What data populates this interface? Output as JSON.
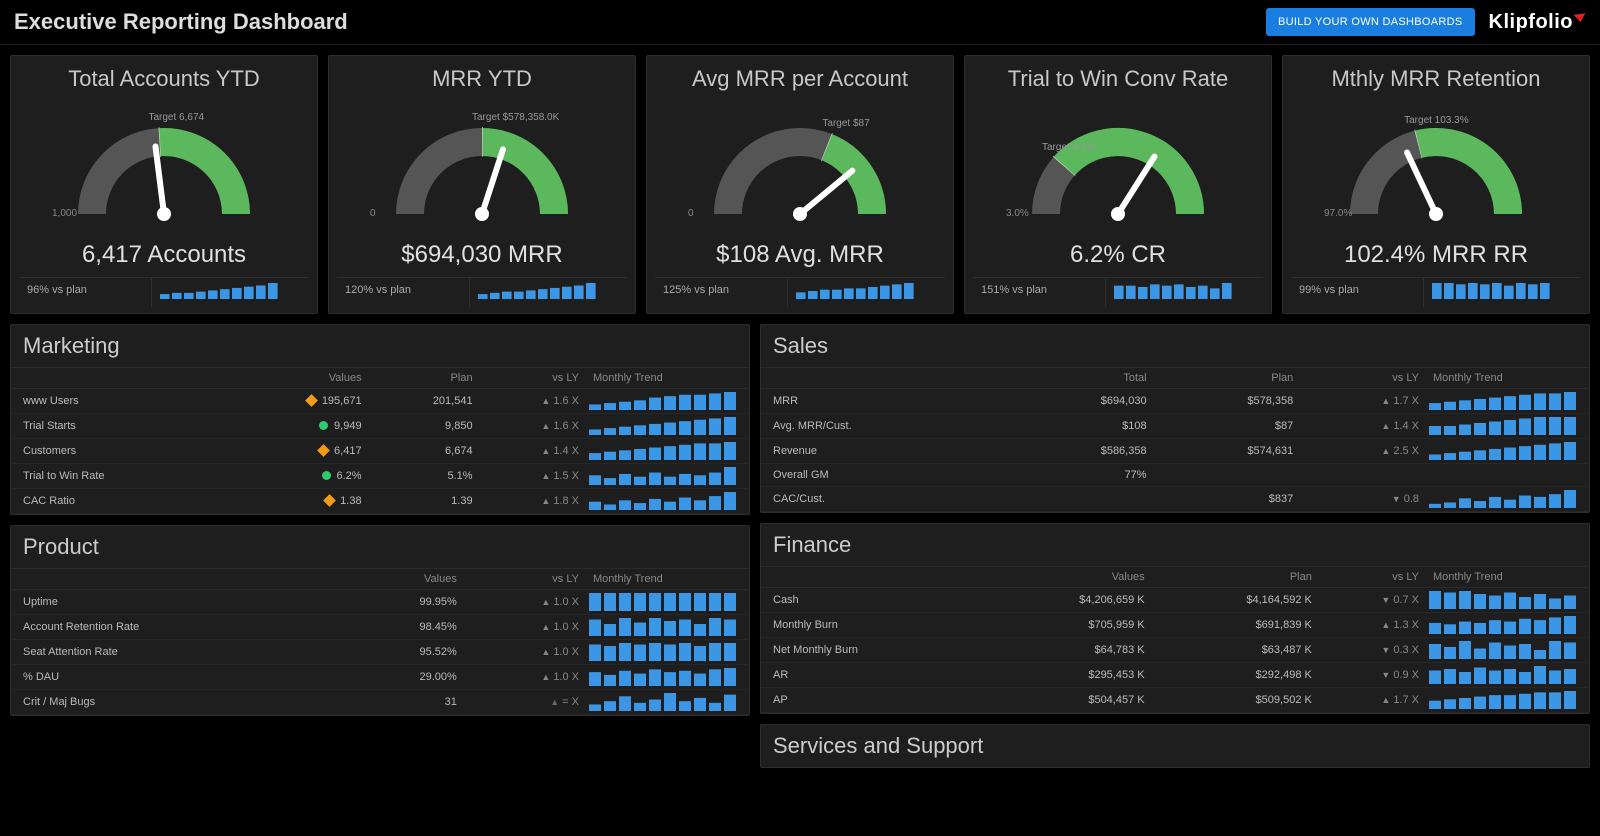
{
  "header": {
    "title": "Executive Reporting Dashboard",
    "button": "BUILD YOUR OWN DASHBOARDS",
    "brand": "Klipfolio"
  },
  "gauges": [
    {
      "title": "Total Accounts YTD",
      "target": "Target 6,674",
      "target_frac": 0.48,
      "min": "1,000",
      "max": "",
      "value_frac": 0.46,
      "readout": "6,417 Accounts",
      "plan": "96% vs plan",
      "spark": [
        4,
        5,
        5,
        6,
        7,
        8,
        9,
        10,
        11,
        13
      ]
    },
    {
      "title": "MRR YTD",
      "target": "Target $578,358.0K",
      "target_frac": 0.5,
      "min": "0",
      "max": "",
      "value_frac": 0.6,
      "readout": "$694,030 MRR",
      "plan": "120% vs plan",
      "spark": [
        4,
        5,
        6,
        6,
        7,
        8,
        9,
        10,
        11,
        13
      ]
    },
    {
      "title": "Avg MRR per Account",
      "target": "Target $87",
      "target_frac": 0.62,
      "min": "0",
      "max": "",
      "value_frac": 0.78,
      "readout": "$108 Avg. MRR",
      "plan": "125% vs plan",
      "spark": [
        5,
        6,
        7,
        7,
        8,
        8,
        9,
        10,
        11,
        12
      ]
    },
    {
      "title": "Trial to Win Conv Rate",
      "target": "Target 4.1%",
      "target_frac": 0.23,
      "min": "3.0%",
      "max": "",
      "value_frac": 0.68,
      "readout": "6.2% CR",
      "plan": "151% vs plan",
      "spark": [
        10,
        10,
        9,
        11,
        10,
        11,
        9,
        10,
        8,
        12
      ]
    },
    {
      "title": "Mthly MRR Retention",
      "target": "Target 103.3%",
      "target_frac": 0.42,
      "min": "97.0%",
      "max": "",
      "value_frac": 0.36,
      "readout": "102.4% MRR RR",
      "plan": "99% vs plan",
      "spark": [
        12,
        12,
        11,
        12,
        11,
        12,
        10,
        12,
        11,
        12
      ]
    }
  ],
  "marketing": {
    "title": "Marketing",
    "headers": [
      "",
      "Values",
      "Plan",
      "vs LY",
      "Monthly Trend"
    ],
    "rows": [
      {
        "label": "www Users",
        "marker": "orange",
        "value": "195,671",
        "plan": "201,541",
        "vsly": "1.6 X",
        "dir": "up",
        "spark": [
          4,
          5,
          6,
          7,
          9,
          10,
          11,
          11,
          12,
          13
        ]
      },
      {
        "label": "Trial Starts",
        "marker": "green",
        "value": "9,949",
        "plan": "9,850",
        "vsly": "1.6 X",
        "dir": "up",
        "spark": [
          4,
          5,
          6,
          7,
          8,
          9,
          10,
          11,
          12,
          13
        ]
      },
      {
        "label": "Customers",
        "marker": "orange",
        "value": "6,417",
        "plan": "6,674",
        "vsly": "1.4 X",
        "dir": "up",
        "spark": [
          5,
          6,
          7,
          8,
          9,
          10,
          11,
          12,
          12,
          13
        ]
      },
      {
        "label": "Trial to Win Rate",
        "marker": "green",
        "value": "6.2%",
        "plan": "5.1%",
        "vsly": "1.5 X",
        "dir": "up",
        "divider": true,
        "spark": [
          7,
          5,
          8,
          6,
          9,
          6,
          8,
          7,
          9,
          13
        ]
      },
      {
        "label": "CAC Ratio",
        "marker": "orange",
        "value": "1.38",
        "plan": "1.39",
        "vsly": "1.8 X",
        "dir": "up",
        "spark": [
          6,
          4,
          7,
          5,
          8,
          6,
          9,
          7,
          10,
          13
        ]
      }
    ]
  },
  "product": {
    "title": "Product",
    "headers": [
      "",
      "Values",
      "vs LY",
      "Monthly Trend"
    ],
    "rows": [
      {
        "label": "Uptime",
        "value": "99.95%",
        "vsly": "1.0 X",
        "dir": "up",
        "spark": [
          12,
          12,
          12,
          12,
          12,
          12,
          12,
          12,
          12,
          12
        ]
      },
      {
        "label": "Account Retention Rate",
        "value": "98.45%",
        "vsly": "1.0 X",
        "dir": "up",
        "spark": [
          11,
          8,
          12,
          9,
          12,
          10,
          11,
          8,
          12,
          11
        ]
      },
      {
        "label": "Seat Attention Rate",
        "value": "95.52%",
        "vsly": "1.0 X",
        "dir": "up",
        "spark": [
          11,
          10,
          12,
          11,
          12,
          11,
          12,
          10,
          12,
          12
        ]
      },
      {
        "label": "% DAU",
        "value": "29.00%",
        "vsly": "1.0 X",
        "dir": "up",
        "spark": [
          10,
          8,
          11,
          9,
          12,
          10,
          11,
          9,
          12,
          13
        ]
      },
      {
        "label": "Crit / Maj Bugs",
        "value": "31",
        "vsly": "= X",
        "dir": "eq",
        "divider": true,
        "spark": [
          4,
          6,
          9,
          5,
          7,
          11,
          6,
          8,
          5,
          10
        ]
      }
    ]
  },
  "sales": {
    "title": "Sales",
    "headers": [
      "",
      "Total",
      "Plan",
      "vs LY",
      "Monthly Trend"
    ],
    "rows": [
      {
        "label": "MRR",
        "value": "$694,030",
        "plan": "$578,358",
        "vsly": "1.7 X",
        "dir": "up",
        "spark": [
          5,
          6,
          7,
          8,
          9,
          10,
          11,
          12,
          12,
          13
        ]
      },
      {
        "label": "Avg. MRR/Cust.",
        "value": "$108",
        "plan": "$87",
        "vsly": "1.4 X",
        "dir": "up",
        "spark": [
          6,
          6,
          7,
          8,
          9,
          10,
          11,
          12,
          12,
          12
        ]
      },
      {
        "label": "Revenue",
        "value": "$586,358",
        "plan": "$574,631",
        "vsly": "2.5 X",
        "dir": "up",
        "spark": [
          4,
          5,
          6,
          7,
          8,
          9,
          10,
          11,
          12,
          13
        ]
      },
      {
        "label": "Overall GM",
        "value": "77%",
        "plan": "",
        "vsly": "",
        "dir": "",
        "divider": true,
        "spark": []
      },
      {
        "label": "CAC/Cust.",
        "value": "",
        "plan": "$837",
        "vsly": "0.8",
        "dir": "dn",
        "divider": true,
        "spark": [
          3,
          4,
          7,
          5,
          8,
          6,
          9,
          8,
          10,
          13
        ]
      }
    ]
  },
  "finance": {
    "title": "Finance",
    "headers": [
      "",
      "Values",
      "Plan",
      "vs LY",
      "Monthly Trend"
    ],
    "rows": [
      {
        "label": "Cash",
        "value": "$4,206,659 K",
        "plan": "$4,164,592 K",
        "vsly": "0.7 X",
        "dir": "dn",
        "spark": [
          12,
          11,
          12,
          10,
          9,
          11,
          8,
          10,
          7,
          9
        ]
      },
      {
        "label": "Monthly Burn",
        "value": "$705,959 K",
        "plan": "$691,839 K",
        "vsly": "1.3 X",
        "dir": "up",
        "spark": [
          8,
          7,
          9,
          8,
          10,
          9,
          11,
          10,
          12,
          13
        ]
      },
      {
        "label": "Net Monthly Burn",
        "value": "$64,783 K",
        "plan": "$63,487 K",
        "vsly": "0.3 X",
        "dir": "dn",
        "spark": [
          10,
          8,
          12,
          7,
          11,
          9,
          10,
          6,
          12,
          11
        ]
      },
      {
        "label": "AR",
        "value": "$295,453 K",
        "plan": "$292,498 K",
        "vsly": "0.9 X",
        "dir": "dn",
        "spark": [
          9,
          10,
          8,
          11,
          9,
          10,
          8,
          12,
          9,
          10
        ]
      },
      {
        "label": "AP",
        "value": "$504,457 K",
        "plan": "$509,502 K",
        "vsly": "1.7 X",
        "dir": "up",
        "spark": [
          6,
          7,
          8,
          9,
          10,
          10,
          11,
          12,
          12,
          13
        ]
      }
    ]
  },
  "services": {
    "title": "Services and Support"
  },
  "chart_data": {
    "type": "gauge",
    "gauges": [
      {
        "name": "Total Accounts YTD",
        "value": 6417,
        "target": 6674,
        "min": 1000,
        "unit": "Accounts",
        "vs_plan_pct": 96
      },
      {
        "name": "MRR YTD",
        "value": 694030,
        "target": 578358,
        "min": 0,
        "unit": "MRR $",
        "vs_plan_pct": 120
      },
      {
        "name": "Avg MRR per Account",
        "value": 108,
        "target": 87,
        "min": 0,
        "unit": "$",
        "vs_plan_pct": 125
      },
      {
        "name": "Trial to Win Conv Rate",
        "value": 6.2,
        "target": 4.1,
        "min": 3.0,
        "unit": "%",
        "vs_plan_pct": 151
      },
      {
        "name": "Mthly MRR Retention",
        "value": 102.4,
        "target": 103.3,
        "min": 97.0,
        "unit": "%",
        "vs_plan_pct": 99
      }
    ]
  }
}
